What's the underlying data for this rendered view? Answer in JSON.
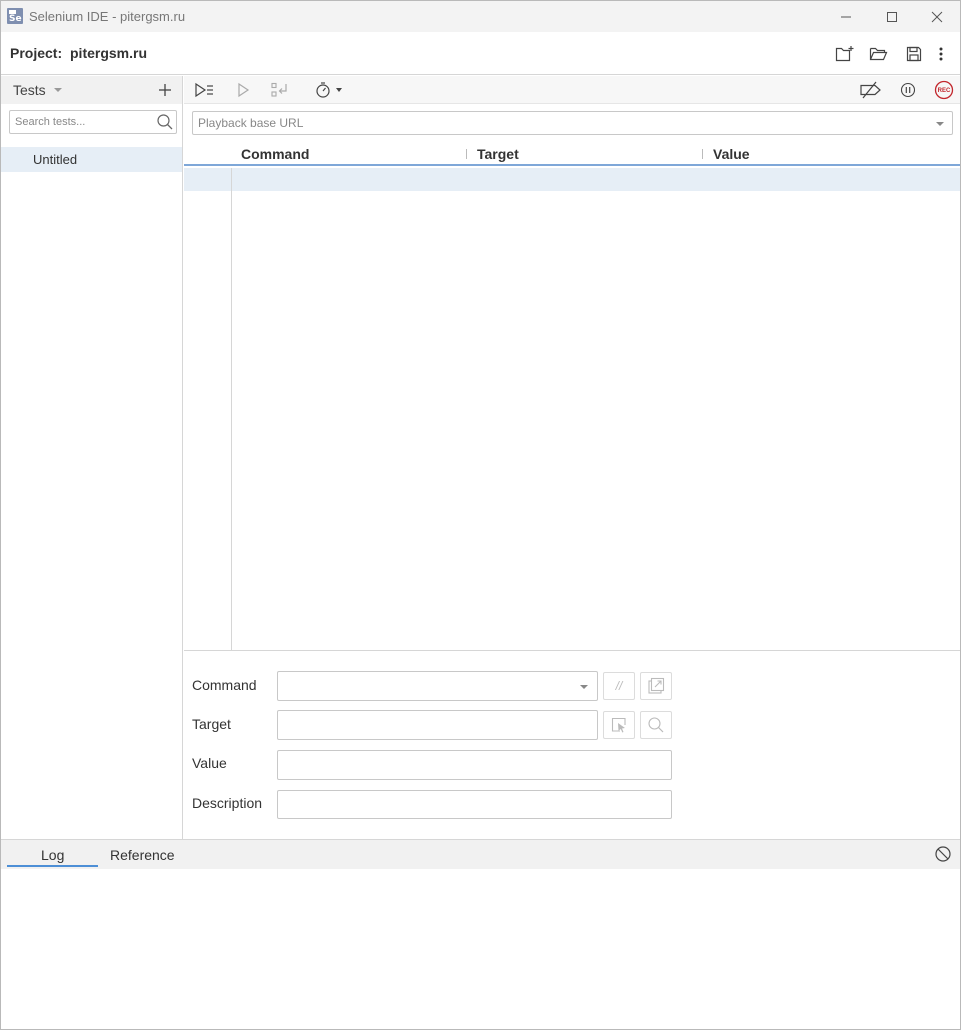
{
  "window": {
    "title": "Selenium IDE - pitergsm.ru",
    "app_icon_text": "Se"
  },
  "project": {
    "label": "Project:",
    "name": "pitergsm.ru"
  },
  "sidebar": {
    "tests_dropdown_label": "Tests",
    "search_placeholder": "Search tests...",
    "tests": [
      {
        "name": "Untitled",
        "selected": true
      }
    ]
  },
  "toolbar": {
    "icons": [
      "run-all-tests-icon",
      "run-current-test-icon",
      "step-over-icon",
      "test-speed-icon",
      "disable-breakpoints-icon",
      "pause-on-exceptions-icon",
      "record-icon"
    ],
    "record_label": "REC"
  },
  "playback": {
    "base_url_placeholder": "Playback base URL"
  },
  "grid": {
    "columns": [
      "Command",
      "Target",
      "Value"
    ],
    "rows": []
  },
  "editor": {
    "command_label": "Command",
    "target_label": "Target",
    "value_label": "Value",
    "description_label": "Description",
    "command_value": "",
    "target_value": "",
    "value_value": "",
    "description_value": "",
    "comment_button_label": "//"
  },
  "bottom_panel": {
    "tabs": [
      {
        "label": "Log",
        "active": true
      },
      {
        "label": "Reference",
        "active": false
      }
    ]
  },
  "colors": {
    "accent": "#4d8fd6",
    "selection": "#e6eef6",
    "record": "#c2272d"
  }
}
